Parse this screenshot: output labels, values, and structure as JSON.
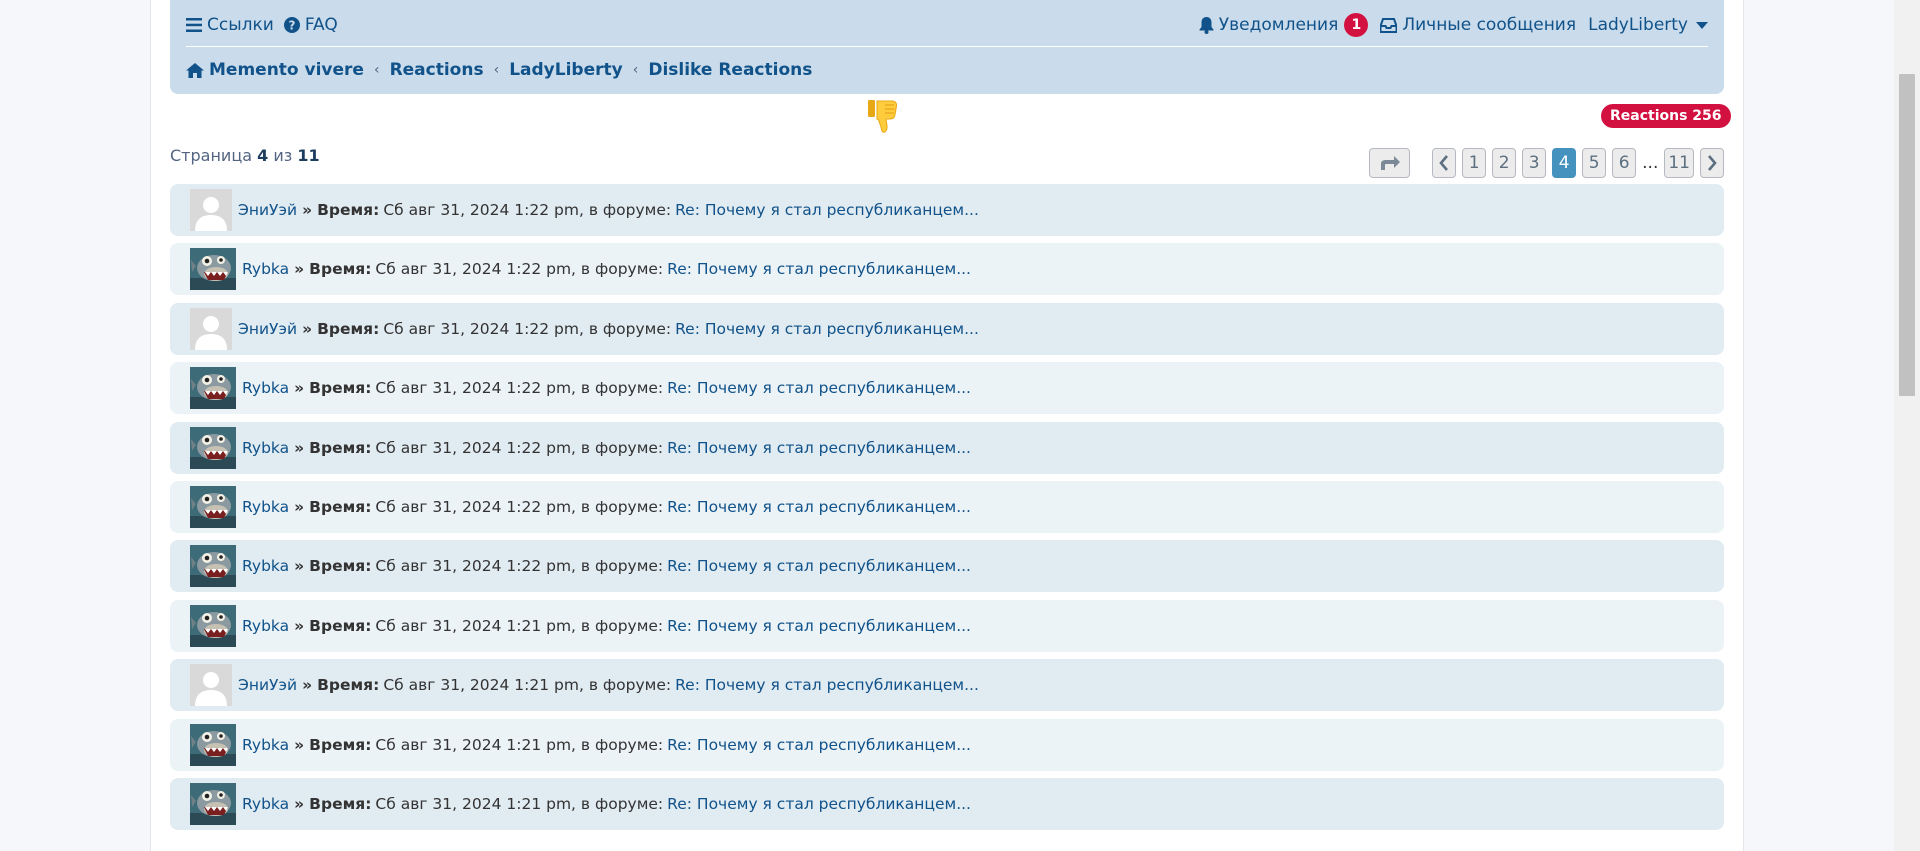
{
  "nav": {
    "links_label": "Ссылки",
    "faq_label": "FAQ",
    "notifications_label": "Уведомления",
    "notifications_count": "1",
    "messages_label": "Личные сообщения",
    "user_label": "LadyLiberty"
  },
  "breadcrumbs": [
    "Memento vivere",
    "Reactions",
    "LadyLiberty",
    "Dislike Reactions"
  ],
  "reactions_badge": "Reactions 256",
  "page_info": {
    "prefix": "Страница",
    "current": "4",
    "middle": "из",
    "total": "11"
  },
  "pagination": {
    "pages": [
      "1",
      "2",
      "3",
      "4",
      "5",
      "6"
    ],
    "ellipsis": "...",
    "last": "11",
    "active": "4"
  },
  "entries": [
    {
      "user": "ЭниУэй",
      "avatar": "default",
      "sep": "»",
      "time_label": "Время:",
      "time": "Сб авг 31, 2024 1:22 pm, в форуме:",
      "topic": "Re: Почему я стал республиканцем..."
    },
    {
      "user": "Rybka",
      "avatar": "fish",
      "sep": "»",
      "time_label": "Время:",
      "time": "Сб авг 31, 2024 1:22 pm, в форуме:",
      "topic": "Re: Почему я стал республиканцем..."
    },
    {
      "user": "ЭниУэй",
      "avatar": "default",
      "sep": "»",
      "time_label": "Время:",
      "time": "Сб авг 31, 2024 1:22 pm, в форуме:",
      "topic": "Re: Почему я стал республиканцем..."
    },
    {
      "user": "Rybka",
      "avatar": "fish",
      "sep": "»",
      "time_label": "Время:",
      "time": "Сб авг 31, 2024 1:22 pm, в форуме:",
      "topic": "Re: Почему я стал республиканцем..."
    },
    {
      "user": "Rybka",
      "avatar": "fish",
      "sep": "»",
      "time_label": "Время:",
      "time": "Сб авг 31, 2024 1:22 pm, в форуме:",
      "topic": "Re: Почему я стал республиканцем..."
    },
    {
      "user": "Rybka",
      "avatar": "fish",
      "sep": "»",
      "time_label": "Время:",
      "time": "Сб авг 31, 2024 1:22 pm, в форуме:",
      "topic": "Re: Почему я стал республиканцем..."
    },
    {
      "user": "Rybka",
      "avatar": "fish",
      "sep": "»",
      "time_label": "Время:",
      "time": "Сб авг 31, 2024 1:22 pm, в форуме:",
      "topic": "Re: Почему я стал республиканцем..."
    },
    {
      "user": "Rybka",
      "avatar": "fish",
      "sep": "»",
      "time_label": "Время:",
      "time": "Сб авг 31, 2024 1:21 pm, в форуме:",
      "topic": "Re: Почему я стал республиканцем..."
    },
    {
      "user": "ЭниУэй",
      "avatar": "default",
      "sep": "»",
      "time_label": "Время:",
      "time": "Сб авг 31, 2024 1:21 pm, в форуме:",
      "topic": "Re: Почему я стал республиканцем..."
    },
    {
      "user": "Rybka",
      "avatar": "fish",
      "sep": "»",
      "time_label": "Время:",
      "time": "Сб авг 31, 2024 1:21 pm, в форуме:",
      "topic": "Re: Почему я стал республиканцем..."
    },
    {
      "user": "Rybka",
      "avatar": "fish",
      "sep": "»",
      "time_label": "Время:",
      "time": "Сб авг 31, 2024 1:21 pm, в форуме:",
      "topic": "Re: Почему я стал республиканцем..."
    }
  ],
  "colors": {
    "navbar_bg": "#cadceb",
    "link": "#105289",
    "badge": "#d31141",
    "active_page": "#4692bf",
    "row_odd": "#e1ebf2",
    "row_even": "#ecf3f7"
  }
}
